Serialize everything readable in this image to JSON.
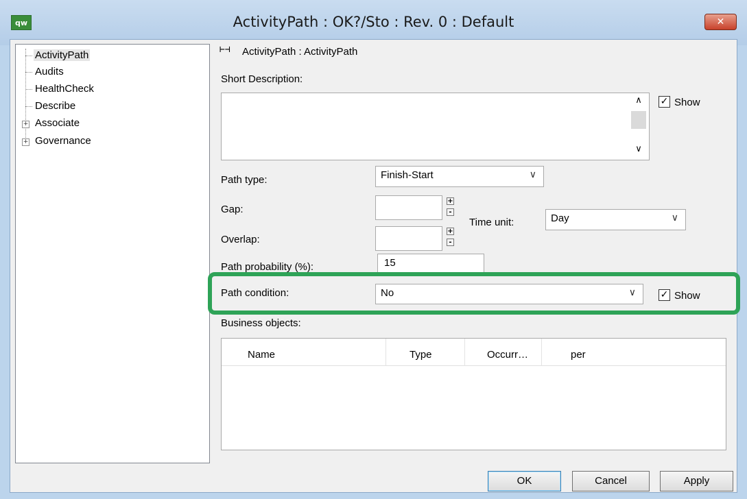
{
  "window": {
    "title": "ActivityPath : OK?/Sto : Rev. 0  : Default",
    "app_icon": "qw",
    "close_icon": "✕"
  },
  "tree": {
    "items": [
      {
        "label": "ActivityPath",
        "selected": true
      },
      {
        "label": "Audits"
      },
      {
        "label": "HealthCheck"
      },
      {
        "label": "Describe"
      },
      {
        "label": "Associate",
        "expandable": true
      },
      {
        "label": "Governance",
        "expandable": true
      }
    ]
  },
  "header": {
    "icon": "path-link-icon",
    "breadcrumb": "ActivityPath : ActivityPath"
  },
  "form": {
    "short_description_label": "Short Description:",
    "short_description_value": "",
    "show_label": "Show",
    "path_type_label": "Path type:",
    "path_type_value": "Finish-Start",
    "gap_label": "Gap:",
    "overlap_label": "Overlap:",
    "time_unit_label": "Time unit:",
    "time_unit_value": "Day",
    "path_probability_label": "Path probability (%):",
    "path_probability_value": "15",
    "path_condition_label": "Path condition:",
    "path_condition_value": "No",
    "path_condition_show_label": "Show",
    "business_objects_label": "Business objects:"
  },
  "grid": {
    "columns": [
      "Name",
      "Type",
      "Occurr…",
      "per"
    ],
    "rows": []
  },
  "buttons": {
    "ok": "OK",
    "cancel": "Cancel",
    "apply": "Apply"
  },
  "colors": {
    "highlight": "#2ea357",
    "titlebar": "#b4cde8",
    "close": "#c8412b"
  }
}
